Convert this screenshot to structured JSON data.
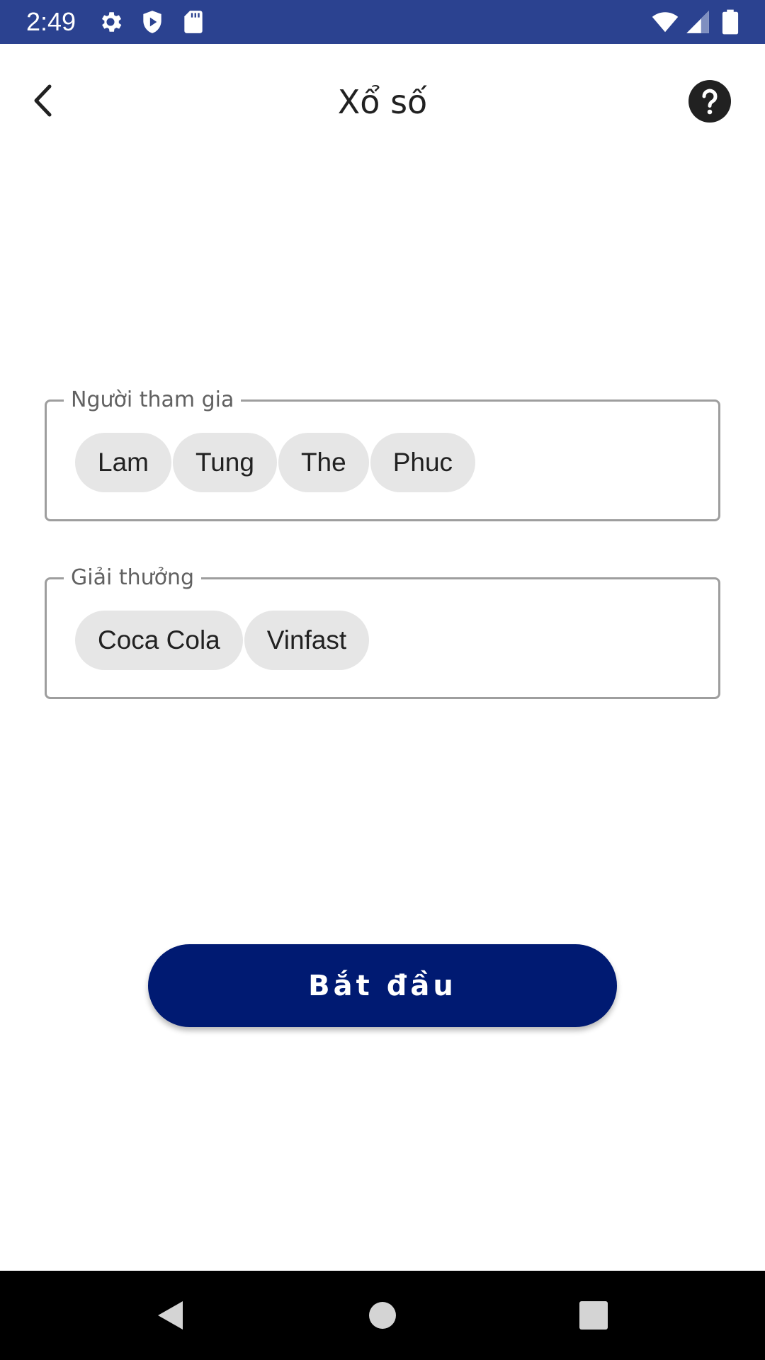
{
  "status_bar": {
    "time": "2:49",
    "background_color": "#2b4290",
    "left_icons": [
      "gear-icon",
      "shield-play-icon",
      "sd-card-icon"
    ],
    "right_icons": [
      "wifi-icon",
      "cell-signal-icon",
      "battery-icon"
    ]
  },
  "app_bar": {
    "title": "Xổ số",
    "back_icon": "chevron-left-icon",
    "help_icon": "question-mark-icon"
  },
  "participants": {
    "label": "Người tham gia",
    "chips": [
      "Lam",
      "Tung",
      "The",
      "Phuc"
    ]
  },
  "prizes": {
    "label": "Giải thưởng",
    "chips": [
      "Coca Cola",
      "Vinfast"
    ]
  },
  "start_button": {
    "label": "Bắt đầu",
    "color": "#001a72"
  },
  "nav_bar": {
    "icons": [
      "back-triangle-icon",
      "home-circle-icon",
      "recents-square-icon"
    ]
  }
}
